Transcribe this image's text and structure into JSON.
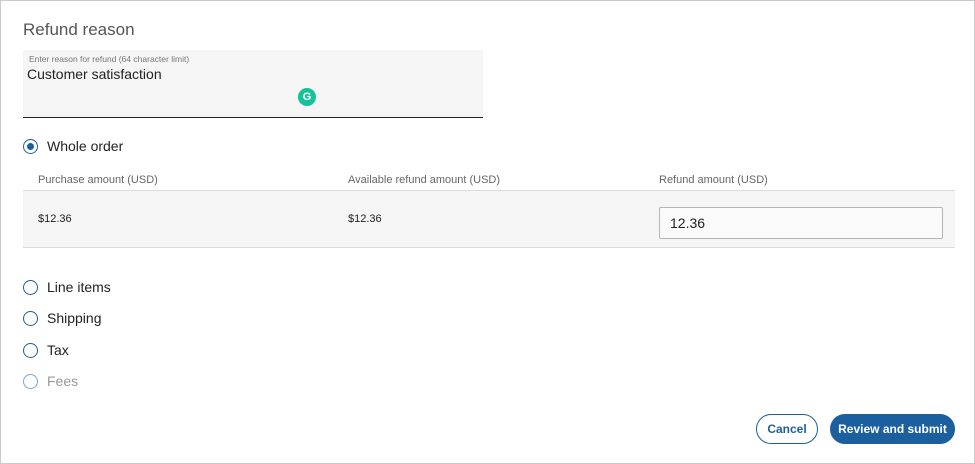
{
  "refund_reason": {
    "title": "Refund reason",
    "placeholder": "Enter reason for refund (64 character limit)",
    "value": "Customer satisfaction"
  },
  "options": {
    "whole_order": "Whole order",
    "line_items": "Line items",
    "shipping": "Shipping",
    "tax": "Tax",
    "fees": "Fees",
    "selected": "Whole order"
  },
  "table": {
    "headers": [
      "Purchase amount (USD)",
      "Available refund amount (USD)",
      "Refund amount (USD)"
    ],
    "purchase_amount": "$12.36",
    "available_amount": "$12.36",
    "refund_amount": "12.36"
  },
  "actions": {
    "cancel": "Cancel",
    "submit": "Review and submit"
  },
  "colors": {
    "accent": "#1c5f9e",
    "grammarly": "#15c39a"
  }
}
